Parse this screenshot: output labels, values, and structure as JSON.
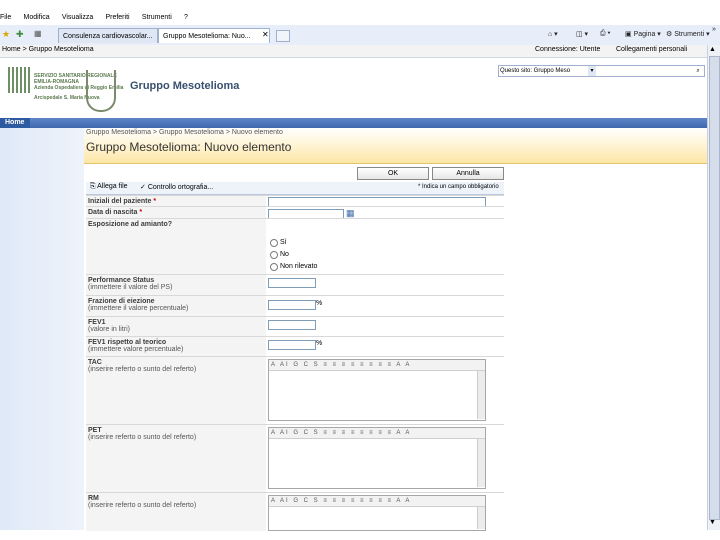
{
  "browser": {
    "menu": [
      "File",
      "Modifica",
      "Visualizza",
      "Preferiti",
      "Strumenti",
      "?"
    ],
    "tabs": [
      "Consulenza cardiovascolar...",
      "Gruppo Mesotelioma: Nuo..."
    ],
    "tools": [
      "Pagina",
      "Strumenti"
    ],
    "breadcrumb_top": "Home > Gruppo Mesotelioma",
    "welcome": "Connessione: Utente",
    "personal": "Collegamenti personali"
  },
  "site": {
    "org_lines": [
      "SERVIZIO SANITARIO REGIONALE",
      "EMILIA-ROMAGNA",
      "Azienda Ospedaliera di Reggio Emilia",
      "Arcispedale S. Maria Nuova"
    ],
    "title": "Gruppo Mesotelioma",
    "search_scope": "Questo sito: Gruppo Meso",
    "nav_home": "Home"
  },
  "page": {
    "breadcrumb": "Gruppo Mesotelioma > Gruppo Mesotelioma > Nuovo elemento",
    "title": "Gruppo Mesotelioma: Nuovo elemento",
    "ok": "OK",
    "cancel": "Annulla",
    "attach": "Allega file",
    "spell": "Controllo ortografia...",
    "required_note": "* Indica un campo obbligatorio"
  },
  "form": {
    "initials": "Iniziali del paziente",
    "birth": "Data di nascita",
    "exposure": "Esposizione ad amianto?",
    "exposure_options": [
      "Sì",
      "No",
      "Non rilevato"
    ],
    "ps_label": "Performance Status",
    "ps_sub": "(immettere il valore del PS)",
    "fe_label": "Frazione di eiezione",
    "fe_sub": "(immettere il valore percentuale)",
    "fev1_label": "FEV1",
    "fev1_sub": "(valore in litri)",
    "fev1r_label": "FEV1 rispetto al teorico",
    "fev1r_sub": "(immettere valore percentuale)",
    "pct": "%",
    "tac_label": "TAC",
    "tac_sub": "(inserire referto o sunto del referto)",
    "pet_label": "PET",
    "pet_sub": "(inserire referto o sunto del referto)",
    "rm_label": "RM",
    "rm_sub": "(inserire referto o sunto del referto)",
    "rte_toolbar": "A AI G C S ≡ ≡ ≡ ≡ ≡ ≡ ≡ ≡ A A"
  }
}
